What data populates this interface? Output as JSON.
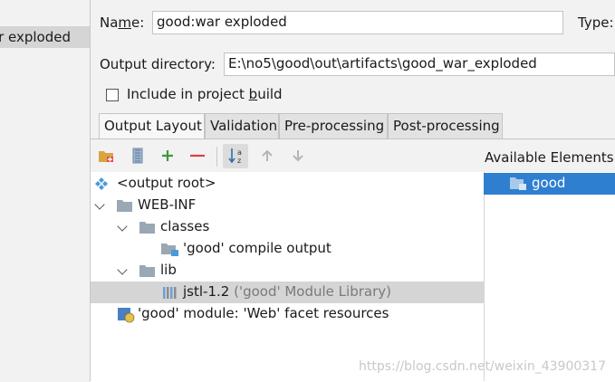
{
  "left_panel": {
    "selected_item": "war exploded"
  },
  "form": {
    "name_label_pre": "Na",
    "name_label_mnemonic": "m",
    "name_label_post": "e:",
    "name_value": "good:war exploded",
    "type_label": "Type:",
    "output_dir_label": "Output directory:",
    "output_dir_value": "E:\\no5\\good\\out\\artifacts\\good_war_exploded",
    "include_label_pre": "Include in project ",
    "include_label_mnemonic": "b",
    "include_label_post": "uild",
    "include_checked": false
  },
  "tabs": [
    {
      "label": "Output Layout",
      "active": true
    },
    {
      "label": "Validation",
      "active": false
    },
    {
      "label": "Pre-processing",
      "active": false
    },
    {
      "label": "Post-processing",
      "active": false
    }
  ],
  "toolbar": {
    "icons": [
      "folder-add-icon",
      "archive-add-icon",
      "add-icon",
      "remove-icon",
      "sort-icon",
      "move-up-icon",
      "move-down-icon"
    ]
  },
  "tree": [
    {
      "label": "<output root>",
      "icon": "output-root-icon"
    },
    {
      "label": "WEB-INF",
      "icon": "folder-icon",
      "expanded": true
    },
    {
      "label": "classes",
      "icon": "folder-icon",
      "expanded": true
    },
    {
      "label": "'good' compile output",
      "icon": "module-output-icon"
    },
    {
      "label": "lib",
      "icon": "folder-icon",
      "expanded": true
    },
    {
      "label": "jstl-1.2",
      "suffix": "('good' Module Library)",
      "icon": "library-icon",
      "selected": true
    },
    {
      "label": "'good' module: 'Web' facet resources",
      "icon": "web-facet-icon"
    }
  ],
  "available": {
    "header": "Available Elements",
    "items": [
      {
        "label": "good",
        "selected": true
      }
    ]
  },
  "watermark": "https://blog.csdn.net/weixin_43900317",
  "colors": {
    "selection_blue": "#2f7fd1",
    "add_green": "#3a9a3a",
    "remove_red": "#d94040"
  }
}
